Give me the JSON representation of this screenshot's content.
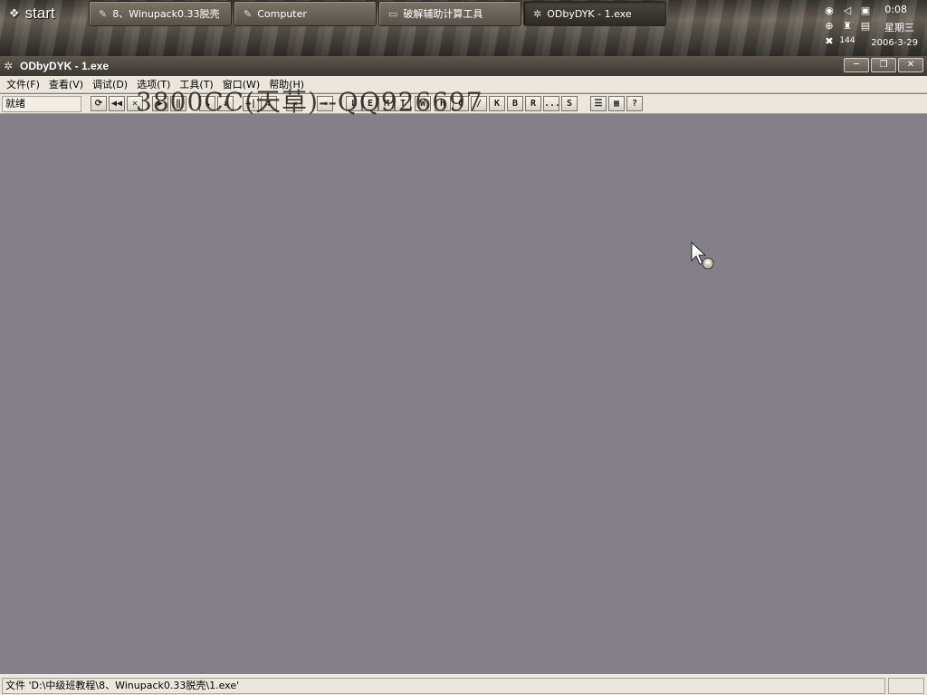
{
  "taskbar": {
    "start_label": "start",
    "tasks": [
      {
        "label": "8、Winupack0.33脱壳",
        "icon": "pencil-icon"
      },
      {
        "label": "Computer",
        "icon": "pencil-icon"
      },
      {
        "label": "破解辅助计算工具",
        "icon": "calculator-icon"
      },
      {
        "label": "ODbyDYK - 1.exe",
        "icon": "debugger-icon"
      }
    ],
    "clock": {
      "time": "0:08",
      "day": "星期三",
      "date": "2006-3-29"
    },
    "tray_badge": "144"
  },
  "window": {
    "title": "ODbyDYK - 1.exe",
    "controls": {
      "minimize": "─",
      "restore": "❐",
      "close": "✕"
    }
  },
  "menu": {
    "items": [
      "文件(F)",
      "查看(V)",
      "调试(D)",
      "选项(T)",
      "工具(T)",
      "窗口(W)",
      "帮助(H)"
    ]
  },
  "toolbar": {
    "status_ready": "就绪",
    "buttons": [
      "⟳",
      "◀◀",
      "✕",
      "▶",
      "‖",
      "↘",
      "↓",
      "→|",
      "↧",
      "⇥",
      "L",
      "E",
      "M",
      "T",
      "W",
      "H",
      "C",
      "/",
      "K",
      "B",
      "R",
      "...",
      "S",
      "☰",
      "▦",
      "?"
    ]
  },
  "watermark": "3800CC(天草)--QQ926697",
  "statusbar": {
    "text": "文件 'D:\\中级班教程\\8、Winupack0.33脱壳\\1.exe'"
  }
}
